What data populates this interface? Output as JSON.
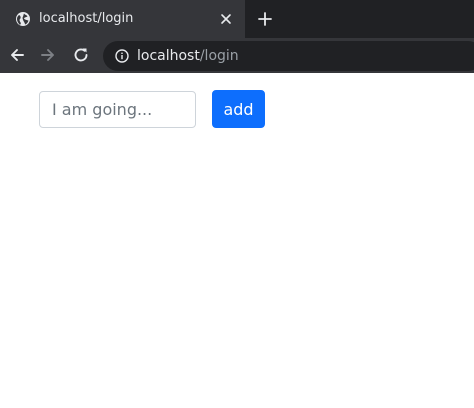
{
  "browser": {
    "tab_title": "localhost/login",
    "url_host": "localhost",
    "url_path": "/login",
    "icons": {
      "favicon": "globe-icon",
      "close": "close-icon",
      "new_tab": "plus-icon",
      "back": "arrow-left-icon",
      "forward": "arrow-right-icon",
      "reload": "reload-icon",
      "site_info": "info-icon"
    }
  },
  "form": {
    "input_placeholder": "I am going...",
    "input_value": "",
    "add_label": "add"
  },
  "colors": {
    "primary": "#0d6efd",
    "chrome_dark": "#202124",
    "chrome_tab": "#35363a"
  }
}
